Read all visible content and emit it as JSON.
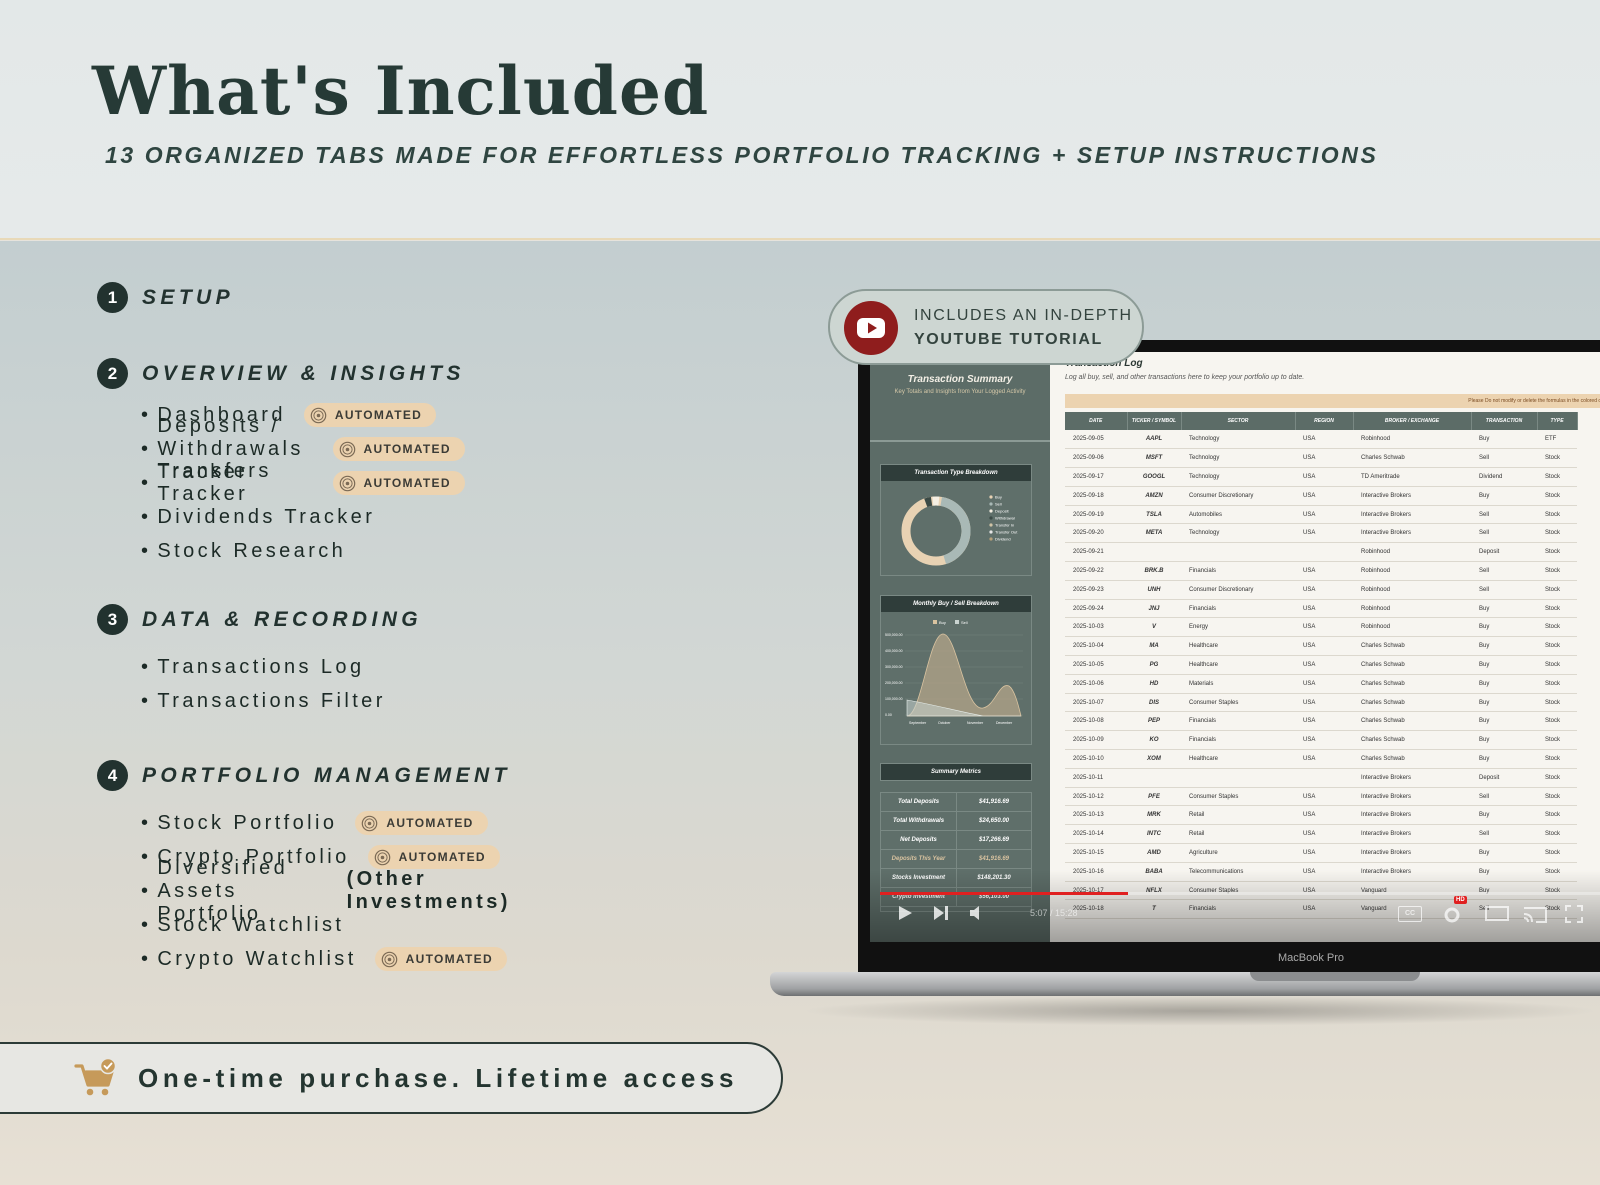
{
  "hero": {
    "title": "What's Included",
    "subtitle": "13 ORGANIZED TABS MADE FOR EFFORTLESS PORTFOLIO TRACKING + SETUP INSTRUCTIONS"
  },
  "badge_label": "AUTOMATED",
  "sections": [
    {
      "num": "1",
      "title": "SETUP",
      "items": []
    },
    {
      "num": "2",
      "title": "OVERVIEW & INSIGHTS",
      "items": [
        {
          "label": "Dashboard",
          "automated": true
        },
        {
          "label": "Deposits / Withdrawals Tracker",
          "automated": true
        },
        {
          "label": "Transfers Tracker",
          "automated": true
        },
        {
          "label": "Dividends Tracker",
          "automated": false
        },
        {
          "label": "Stock Research",
          "automated": false
        }
      ]
    },
    {
      "num": "3",
      "title": "DATA & RECORDING",
      "items": [
        {
          "label": "Transactions Log",
          "automated": false
        },
        {
          "label": "Transactions Filter",
          "automated": false
        }
      ]
    },
    {
      "num": "4",
      "title": "PORTFOLIO MANAGEMENT",
      "items": [
        {
          "label": "Stock Portfolio",
          "automated": true
        },
        {
          "label": "Crypto Portfolio",
          "automated": true
        },
        {
          "label": "Diversified Assets Portfolio",
          "suffix": "(Other Investments)",
          "automated": false
        },
        {
          "label": "Stock Watchlist",
          "automated": false
        },
        {
          "label": "Crypto Watchlist",
          "automated": true
        }
      ]
    }
  ],
  "promo": {
    "text": "One-time purchase. Lifetime access",
    "icon": "shopping-cart-check-icon"
  },
  "tutorial": {
    "line1": "INCLUDES AN IN-DEPTH",
    "line2": "YOUTUBE TUTORIAL",
    "icon": "youtube-icon"
  },
  "laptop": {
    "brand": "MacBook Pro",
    "sidebar": {
      "title": "Transaction Summary",
      "subtitle": "Key Totals and Insights from Your Logged Activity",
      "donut_title": "Transaction Type Breakdown",
      "donut_legend": [
        "Buy",
        "Sell",
        "Deposit",
        "Withdrawal",
        "Transfer In",
        "Transfer Out",
        "Dividend"
      ],
      "area_title": "Monthly Buy / Sell Breakdown",
      "area_legend": [
        "Buy",
        "Sell"
      ],
      "area_y_ticks": [
        "500,000.00",
        "400,000.00",
        "300,000.00",
        "200,000.00",
        "100,000.00",
        "0.00"
      ],
      "area_x_ticks": [
        "September",
        "October",
        "November",
        "December"
      ],
      "metrics_title": "Summary Metrics",
      "metrics": [
        {
          "label": "Total Deposits",
          "value": "$41,916.69"
        },
        {
          "label": "Total Withdrawals",
          "value": "$24,650.00"
        },
        {
          "label": "Net Deposits",
          "value": "$17,266.69"
        },
        {
          "label": "Deposits This Year",
          "value": "$41,916.69"
        },
        {
          "label": "Stocks Investment",
          "value": "$148,201.30"
        },
        {
          "label": "Crypto Investment",
          "value": "$56,103.00"
        }
      ]
    },
    "main": {
      "title": "Transaction Log",
      "subtitle": "Log all buy, sell, and other transactions here to keep your portfolio up to date.",
      "warning": "Please Do not modify or delete the formulas in the colored columns",
      "columns": [
        "DATE",
        "TICKER / SYMBOL",
        "SECTOR",
        "REGION",
        "BROKER / EXCHANGE",
        "TRANSACTION",
        "TYPE"
      ],
      "rows": [
        [
          "2025-09-05",
          "AAPL",
          "Technology",
          "USA",
          "Robinhood",
          "Buy",
          "ETF"
        ],
        [
          "2025-09-06",
          "MSFT",
          "Technology",
          "USA",
          "Charles Schwab",
          "Sell",
          "Stock"
        ],
        [
          "2025-09-17",
          "GOOGL",
          "Technology",
          "USA",
          "TD Ameritrade",
          "Dividend",
          "Stock"
        ],
        [
          "2025-09-18",
          "AMZN",
          "Consumer Discretionary",
          "USA",
          "Interactive Brokers",
          "Buy",
          "Stock"
        ],
        [
          "2025-09-19",
          "TSLA",
          "Automobiles",
          "USA",
          "Interactive Brokers",
          "Sell",
          "Stock"
        ],
        [
          "2025-09-20",
          "META",
          "Technology",
          "USA",
          "Interactive Brokers",
          "Sell",
          "Stock"
        ],
        [
          "2025-09-21",
          "",
          "",
          "",
          "Robinhood",
          "Deposit",
          "Stock"
        ],
        [
          "2025-09-22",
          "BRK.B",
          "Financials",
          "USA",
          "Robinhood",
          "Sell",
          "Stock"
        ],
        [
          "2025-09-23",
          "UNH",
          "Consumer Discretionary",
          "USA",
          "Robinhood",
          "Sell",
          "Stock"
        ],
        [
          "2025-09-24",
          "JNJ",
          "Financials",
          "USA",
          "Robinhood",
          "Buy",
          "Stock"
        ],
        [
          "2025-10-03",
          "V",
          "Energy",
          "USA",
          "Robinhood",
          "Buy",
          "Stock"
        ],
        [
          "2025-10-04",
          "MA",
          "Healthcare",
          "USA",
          "Charles Schwab",
          "Buy",
          "Stock"
        ],
        [
          "2025-10-05",
          "PG",
          "Healthcare",
          "USA",
          "Charles Schwab",
          "Buy",
          "Stock"
        ],
        [
          "2025-10-06",
          "HD",
          "Materials",
          "USA",
          "Charles Schwab",
          "Buy",
          "Stock"
        ],
        [
          "2025-10-07",
          "DIS",
          "Consumer Staples",
          "USA",
          "Charles Schwab",
          "Buy",
          "Stock"
        ],
        [
          "2025-10-08",
          "PEP",
          "Financials",
          "USA",
          "Charles Schwab",
          "Buy",
          "Stock"
        ],
        [
          "2025-10-09",
          "KO",
          "Financials",
          "USA",
          "Charles Schwab",
          "Buy",
          "Stock"
        ],
        [
          "2025-10-10",
          "XOM",
          "Healthcare",
          "USA",
          "Charles Schwab",
          "Buy",
          "Stock"
        ],
        [
          "2025-10-11",
          "",
          "",
          "",
          "Interactive Brokers",
          "Deposit",
          "Stock"
        ],
        [
          "2025-10-12",
          "PFE",
          "Consumer Staples",
          "USA",
          "Interactive Brokers",
          "Sell",
          "Stock"
        ],
        [
          "2025-10-13",
          "MRK",
          "Retail",
          "USA",
          "Interactive Brokers",
          "Buy",
          "Stock"
        ],
        [
          "2025-10-14",
          "INTC",
          "Retail",
          "USA",
          "Interactive Brokers",
          "Sell",
          "Stock"
        ],
        [
          "2025-10-15",
          "AMD",
          "Agriculture",
          "USA",
          "Interactive Brokers",
          "Buy",
          "Stock"
        ],
        [
          "2025-10-16",
          "BABA",
          "Telecommunications",
          "USA",
          "Interactive Brokers",
          "Buy",
          "Stock"
        ],
        [
          "2025-10-17",
          "NFLX",
          "Consumer Staples",
          "USA",
          "Vanguard",
          "Buy",
          "Stock"
        ],
        [
          "2025-10-18",
          "T",
          "Financials",
          "USA",
          "Vanguard",
          "Sell",
          "Stock"
        ]
      ]
    },
    "player": {
      "time": "5:07 / 15:28",
      "progress": 0.34,
      "hd_badge": "HD",
      "cc_label": "CC"
    }
  },
  "colors": {
    "dark": "#22322f",
    "badge": "#ecd3b0",
    "sidebar": "#5c6c67",
    "youtube_red": "#8f1d1d",
    "progress_red": "#e02020"
  }
}
